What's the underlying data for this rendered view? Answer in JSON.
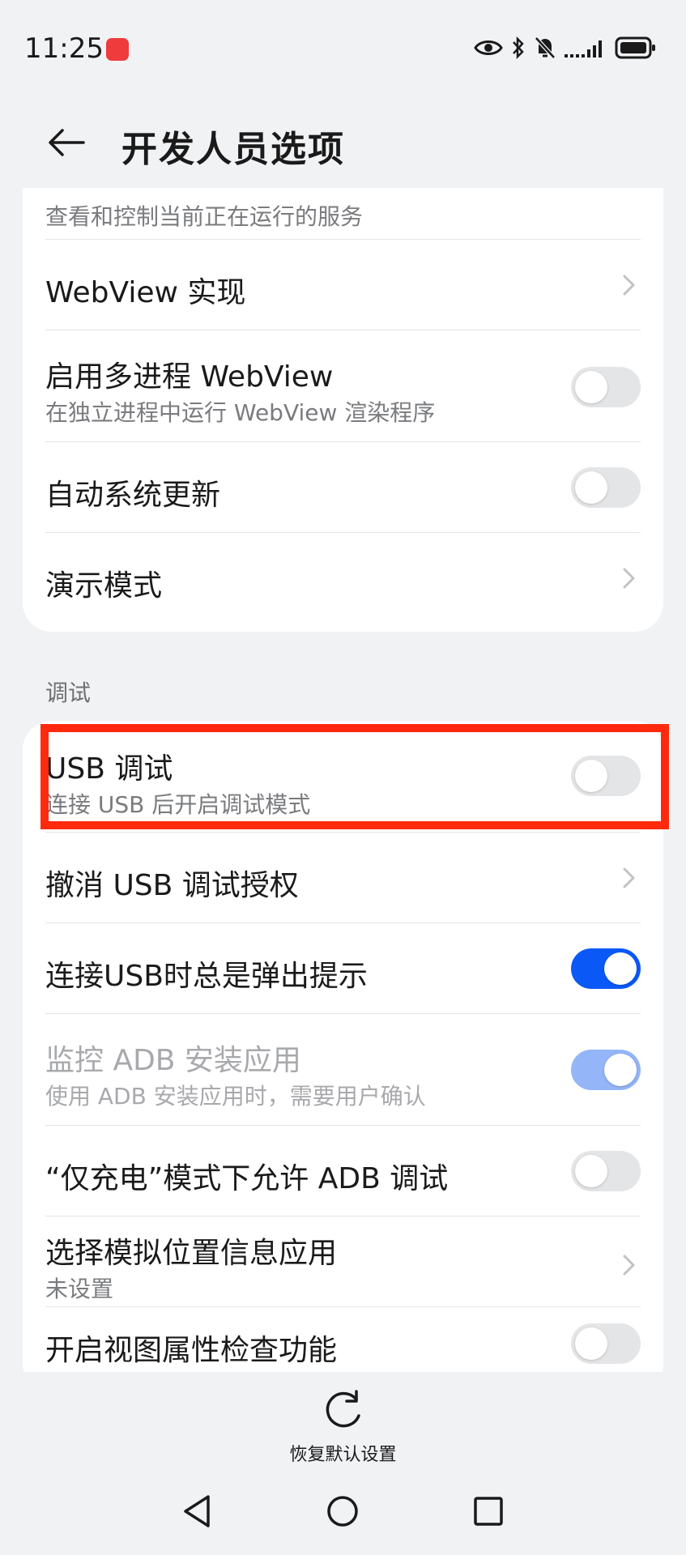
{
  "status_bar": {
    "time": "11:25",
    "icons": [
      "eye-icon",
      "bluetooth-icon",
      "mute-icon",
      "signal-icon",
      "battery-icon"
    ]
  },
  "header": {
    "back_icon": "back-arrow-icon",
    "title": "开发人员选项"
  },
  "card_top": {
    "partial_item": {
      "subtitle": "查看和控制当前正在运行的服务"
    },
    "items": [
      {
        "title": "WebView 实现",
        "control": "chevron"
      },
      {
        "title": "启用多进程 WebView",
        "subtitle": "在独立进程中运行 WebView 渲染程序",
        "control": "toggle",
        "checked": false
      },
      {
        "title": "自动系统更新",
        "control": "toggle",
        "checked": false
      },
      {
        "title": "演示模式",
        "control": "chevron"
      }
    ]
  },
  "section_debug": {
    "label": "调试",
    "items": [
      {
        "title": "USB 调试",
        "subtitle": "连接 USB 后开启调试模式",
        "control": "toggle",
        "checked": false
      },
      {
        "title": "撤消 USB 调试授权",
        "control": "chevron"
      },
      {
        "title": "连接USB时总是弹出提示",
        "control": "toggle",
        "checked": true
      },
      {
        "title": "监控 ADB 安装应用",
        "subtitle": "使用 ADB 安装应用时，需要用户确认",
        "control": "toggle",
        "checked": true,
        "disabled": true
      },
      {
        "title": "“仅充电”模式下允许 ADB 调试",
        "control": "toggle",
        "checked": false
      },
      {
        "title": "选择模拟位置信息应用",
        "subtitle": "未设置",
        "control": "chevron"
      },
      {
        "title": "开启视图属性检查功能",
        "control": "toggle",
        "checked": false
      }
    ]
  },
  "bottom_action": {
    "icon": "reset-icon",
    "label": "恢复默认设置"
  },
  "nav_bar": {
    "icons": [
      "nav-back-icon",
      "nav-home-icon",
      "nav-recents-icon"
    ]
  },
  "colors": {
    "accent": "#0a59f7",
    "accent_disabled": "#94b5f8",
    "highlight": "#ff2a0e",
    "background": "#f1f2f4",
    "status_app": "#ef3b3b"
  }
}
